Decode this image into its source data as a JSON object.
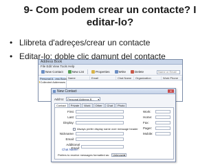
{
  "slide": {
    "title": "9- Com podem crear un contacte? I editar-lo?",
    "bullets": [
      "Llibreta d'adreçes/crear un contacte",
      "Editar-lo: doble clic damunt del contacte"
    ]
  },
  "address_book": {
    "window_title": "Address Book",
    "menu": "File  Edit  View  Tools  Help",
    "toolbar": [
      {
        "label": "New Contact",
        "icon": "new-contact-icon"
      },
      {
        "label": "New List",
        "icon": "new-list-icon"
      },
      {
        "label": "Properties",
        "icon": "properties-icon"
      },
      {
        "label": "Write",
        "icon": "write-icon"
      },
      {
        "label": "Delete",
        "icon": "delete-icon"
      }
    ],
    "search_placeholder": "Name or Email",
    "tree": [
      {
        "label": "Personal A...ess Book",
        "selected": true
      },
      {
        "label": "Collected Addresses",
        "selected": false
      }
    ],
    "columns": [
      "Name",
      "Email",
      "Chat Name",
      "Organization",
      "Work Phone"
    ]
  },
  "new_contact": {
    "title": "New Contact",
    "add_to_label": "Add to:",
    "add_to_value": "Personal Address B...",
    "tabs": [
      "Contact",
      "Private",
      "Work",
      "Other",
      "Chat",
      "Photo"
    ],
    "active_tab": "Contact",
    "left_fields": [
      "First:",
      "Last:",
      "Display:",
      "Nickname:",
      "Email:",
      "Additional Email:"
    ],
    "checkbox_label": "Always prefer display name over message header",
    "right_fields": [
      "Work:",
      "Home:",
      "Fax:",
      "Pager:",
      "Mobile:"
    ],
    "chat_name_label": "Chat Name:",
    "format_label": "Prefers to receive messages formatted as:",
    "format_value": "Unknown"
  }
}
